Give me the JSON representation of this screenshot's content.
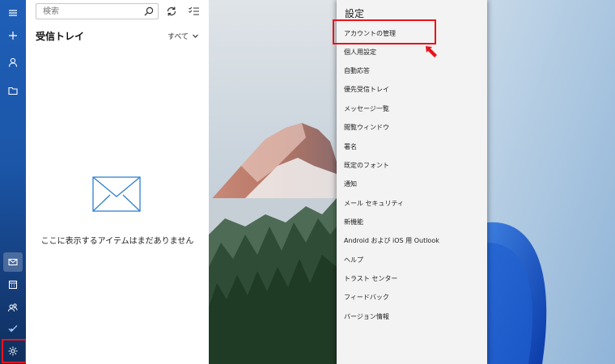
{
  "rail": {
    "items": [
      {
        "name": "menu-icon",
        "active": false
      },
      {
        "name": "compose-icon",
        "active": false
      },
      {
        "name": "account-icon",
        "active": false
      },
      {
        "name": "folders-icon",
        "active": false
      },
      {
        "name": "mail-icon",
        "active": true
      },
      {
        "name": "calendar-icon",
        "active": false
      },
      {
        "name": "people-icon",
        "active": false
      },
      {
        "name": "todo-icon",
        "active": false
      },
      {
        "name": "settings-icon",
        "active": false
      }
    ]
  },
  "panel": {
    "search_placeholder": "検索",
    "folder_title": "受信トレイ",
    "filter_label": "すべて",
    "empty_message": "ここに表示するアイテムはまだありません"
  },
  "settings": {
    "title": "設定",
    "items": [
      "アカウントの管理",
      "個人用設定",
      "自動応答",
      "優先受信トレイ",
      "メッセージ一覧",
      "閲覧ウィンドウ",
      "署名",
      "既定のフォント",
      "通知",
      "メール セキュリティ",
      "新機能",
      "Android および iOS 用 Outlook",
      "ヘルプ",
      "トラスト センター",
      "フィードバック",
      "バージョン情報"
    ]
  },
  "colors": {
    "rail_top": "#1f5fb8",
    "highlight": "#e8141b",
    "settings_bg": "#f3f3f3"
  }
}
